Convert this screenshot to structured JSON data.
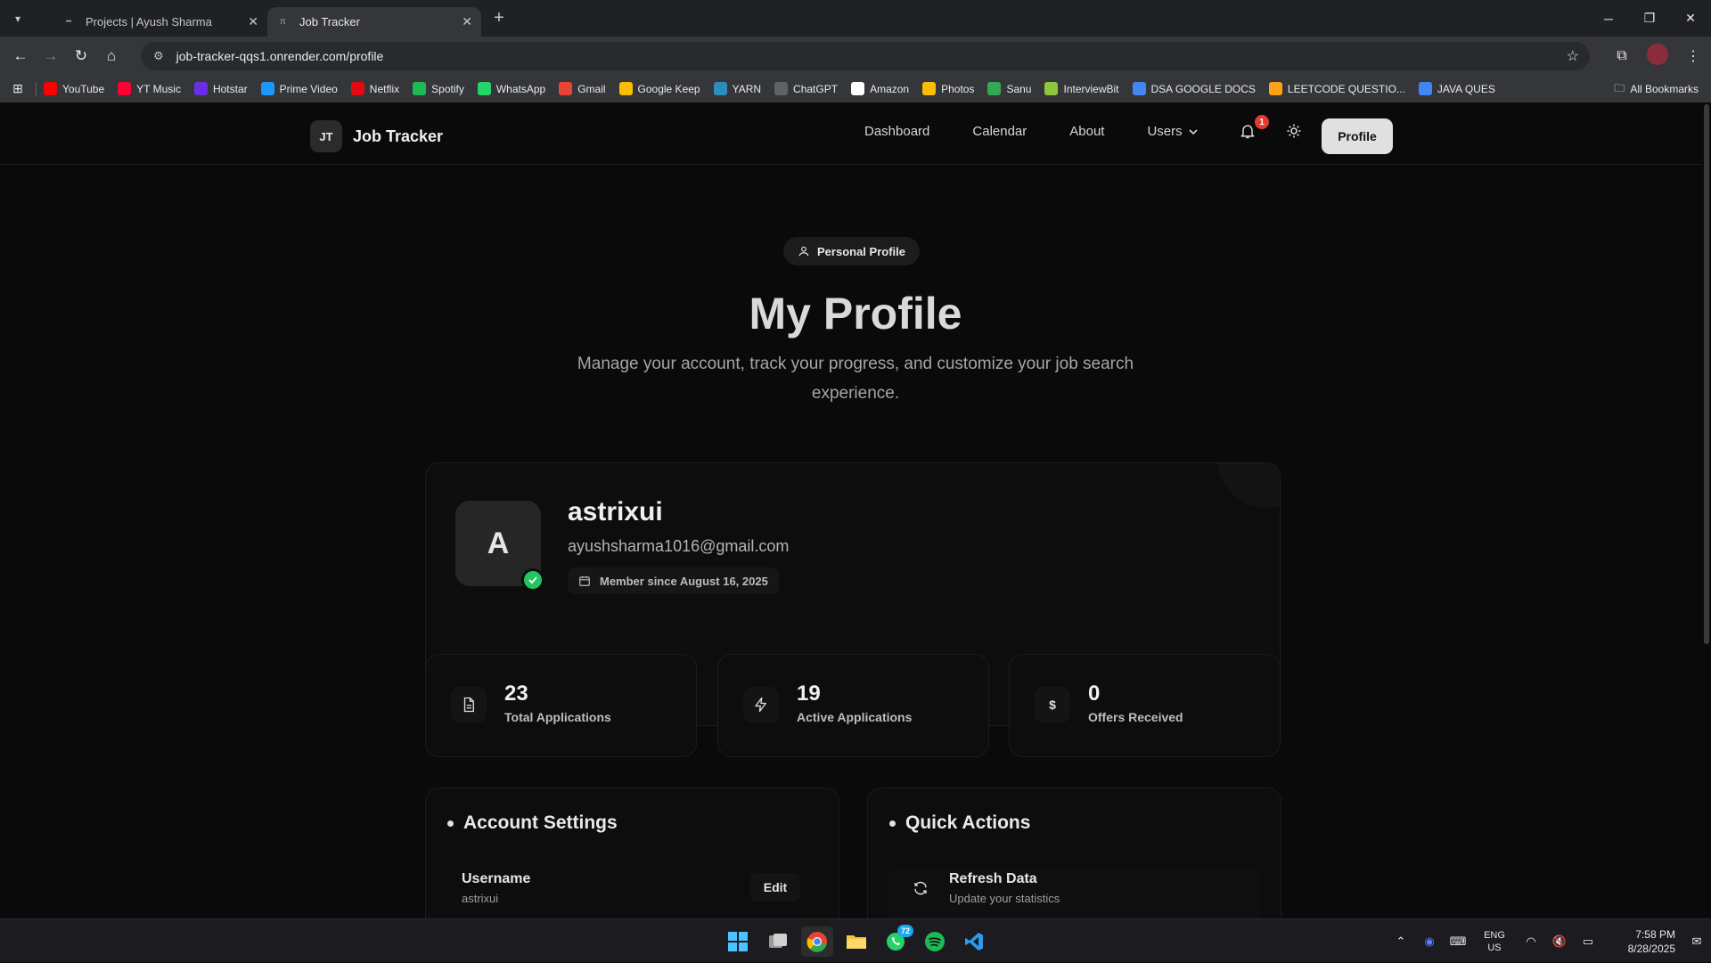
{
  "browser": {
    "tabs": [
      {
        "title": "Projects | Ayush Sharma",
        "active": false
      },
      {
        "title": "Job Tracker",
        "active": true
      }
    ],
    "url": "job-tracker-qqs1.onrender.com/profile",
    "bookmarks": [
      {
        "label": "YouTube",
        "icon": "youtube-icon",
        "color": "#ff0000"
      },
      {
        "label": "YT Music",
        "icon": "yt-music-icon",
        "color": "#ff0033"
      },
      {
        "label": "Hotstar",
        "icon": "hotstar-icon",
        "color": "#6a2ce6"
      },
      {
        "label": "Prime Video",
        "icon": "prime-video-icon",
        "color": "#1a98ff"
      },
      {
        "label": "Netflix",
        "icon": "netflix-icon",
        "color": "#e50914"
      },
      {
        "label": "Spotify",
        "icon": "spotify-icon",
        "color": "#1db954"
      },
      {
        "label": "WhatsApp",
        "icon": "whatsapp-icon",
        "color": "#25d366"
      },
      {
        "label": "Gmail",
        "icon": "gmail-icon",
        "color": "#ea4335"
      },
      {
        "label": "Google Keep",
        "icon": "google-keep-icon",
        "color": "#fbbc04"
      },
      {
        "label": "YARN",
        "icon": "yarn-icon",
        "color": "#2c8ebb"
      },
      {
        "label": "ChatGPT",
        "icon": "chatgpt-icon",
        "color": "#5f6368"
      },
      {
        "label": "Amazon",
        "icon": "amazon-icon",
        "color": "#ffffff"
      },
      {
        "label": "Photos",
        "icon": "photos-icon",
        "color": "#fbbc04"
      },
      {
        "label": "Sanu",
        "icon": "sanu-icon",
        "color": "#34a853"
      },
      {
        "label": "InterviewBit",
        "icon": "interviewbit-icon",
        "color": "#8dc63f"
      },
      {
        "label": "DSA GOOGLE DOCS",
        "icon": "docs-icon",
        "color": "#4285f4"
      },
      {
        "label": "LEETCODE QUESTIO...",
        "icon": "leetcode-icon",
        "color": "#ffa116"
      },
      {
        "label": "JAVA QUES",
        "icon": "docs-icon",
        "color": "#4285f4"
      }
    ],
    "all_bookmarks": "All Bookmarks"
  },
  "nav": {
    "logo_mark": "JT",
    "logo_name": "Job Tracker",
    "links": [
      "Dashboard",
      "Calendar",
      "About"
    ],
    "users": "Users",
    "notification_count": "1",
    "profile": "Profile"
  },
  "hero": {
    "pill": "Personal Profile",
    "title": "My Profile",
    "subtitle": "Manage your account, track your progress, and customize your job search experience."
  },
  "profile": {
    "initial": "A",
    "username": "astrixui",
    "email": "ayushsharma1016@gmail.com",
    "member_since": "Member since August 16, 2025"
  },
  "stats": [
    {
      "value": "23",
      "label": "Total Applications",
      "icon": "document-icon"
    },
    {
      "value": "19",
      "label": "Active Applications",
      "icon": "lightning-icon"
    },
    {
      "value": "0",
      "label": "Offers Received",
      "icon": "dollar-icon",
      "glyph": "$"
    }
  ],
  "account_settings": {
    "title": "Account Settings",
    "username_label": "Username",
    "username_value": "astrixui",
    "edit": "Edit"
  },
  "quick_actions": {
    "title": "Quick Actions",
    "refresh_title": "Refresh Data",
    "refresh_sub": "Update your statistics"
  },
  "taskbar": {
    "whatsapp_badge": "72",
    "lang_top": "ENG",
    "lang_bottom": "US",
    "time": "7:58 PM",
    "date": "8/28/2025"
  },
  "colors": {
    "background": "#0a0a0a",
    "card_border": "#1c1c1c",
    "verified": "#22c55e",
    "badge": "#e53935"
  }
}
